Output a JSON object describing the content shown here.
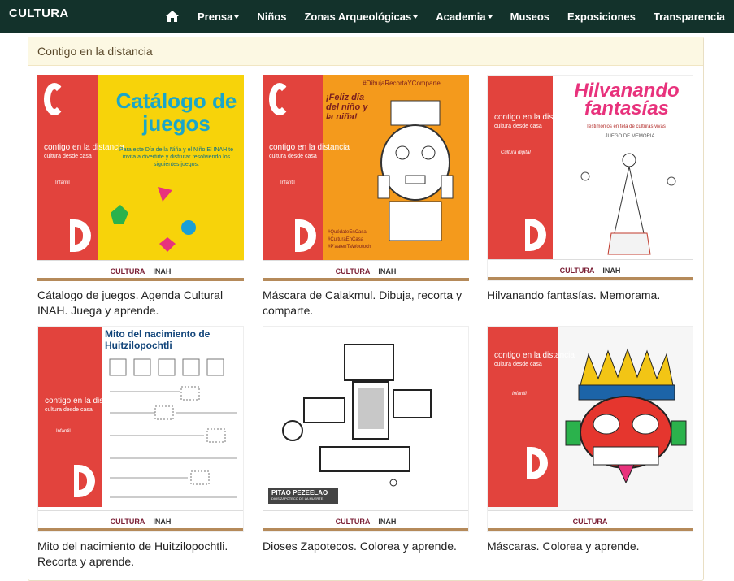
{
  "header": {
    "brand": "CULTURA",
    "nav": [
      {
        "label": "Prensa",
        "dropdown": true
      },
      {
        "label": "Niños",
        "dropdown": false
      },
      {
        "label": "Zonas Arqueológicas",
        "dropdown": true
      },
      {
        "label": "Academia",
        "dropdown": true
      },
      {
        "label": "Museos",
        "dropdown": false
      },
      {
        "label": "Exposiciones",
        "dropdown": false
      },
      {
        "label": "Transparencia",
        "dropdown": false
      }
    ]
  },
  "panel": {
    "title": "Contigo en la distancia"
  },
  "cards": [
    {
      "caption": "Cátalogo de juegos. Agenda Cultural INAH. Juega y aprende.",
      "poster_title": "Catálogo de juegos",
      "poster_text": "Para este Día de la Niña y el Niño El INAH te invita a divertirte y disfrutar resolviendo los siguientes juegos."
    },
    {
      "caption": "Máscara de Calakmul. Dibuja, recorta y comparte.",
      "poster_hashtag": "#DibujaRecortaYComparte",
      "poster_title": "¡Feliz día del niño y la niña!",
      "poster_tags": "#QuédateEnCasa #CulturaEnCasa #P'aatenTaWootoch"
    },
    {
      "caption": "Hilvanando fantasías. Memorama.",
      "poster_title": "Hilvanando fantasías",
      "poster_sub": "Testimonios en tela de culturas vivas",
      "poster_text": "JUEGO DE MEMORIA",
      "poster_tag": "Cultura digital"
    },
    {
      "caption": "Mito del nacimiento de Huitzilopochtli. Recorta y aprende.",
      "poster_title": "Mito del nacimiento de Huitzilopochtli"
    },
    {
      "caption": "Dioses Zapotecos. Colorea y aprende.",
      "poster_title": "PITAO PEZEELAO",
      "poster_sub": "DIOS ZAPOTECO DE LA MUERTE"
    },
    {
      "caption": "Máscaras. Colorea y aprende.",
      "poster_tag": "Infantil"
    }
  ],
  "poster_common": {
    "contigo": "contigo en la distancia",
    "sub": "cultura desde casa",
    "tag": "Infantil",
    "footer_left": "CULTURA",
    "footer_right": "INAH"
  }
}
